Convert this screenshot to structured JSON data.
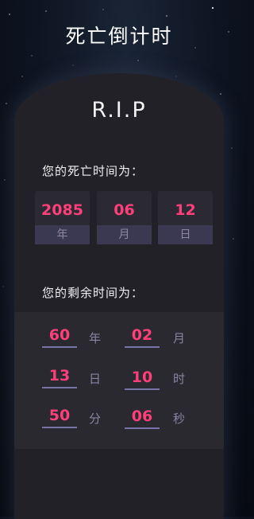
{
  "app_title": "死亡倒计时",
  "rip": "R.I.P",
  "death_label": "您的死亡时间为：",
  "death_date": [
    {
      "value": "2085",
      "unit": "年"
    },
    {
      "value": "06",
      "unit": "月"
    },
    {
      "value": "12",
      "unit": "日"
    }
  ],
  "remaining_label": "您的剩余时间为：",
  "remaining": {
    "years": {
      "value": "60",
      "unit": "年"
    },
    "months": {
      "value": "02",
      "unit": "月"
    },
    "days": {
      "value": "13",
      "unit": "日"
    },
    "hours": {
      "value": "10",
      "unit": "时"
    },
    "minutes": {
      "value": "50",
      "unit": "分"
    },
    "seconds": {
      "value": "06",
      "unit": "秒"
    }
  },
  "colors": {
    "accent": "#ff3f7a",
    "tomb": "#232128",
    "panel": "#2a2930",
    "unit_text": "#8a84a3",
    "underline": "#7773a8"
  }
}
